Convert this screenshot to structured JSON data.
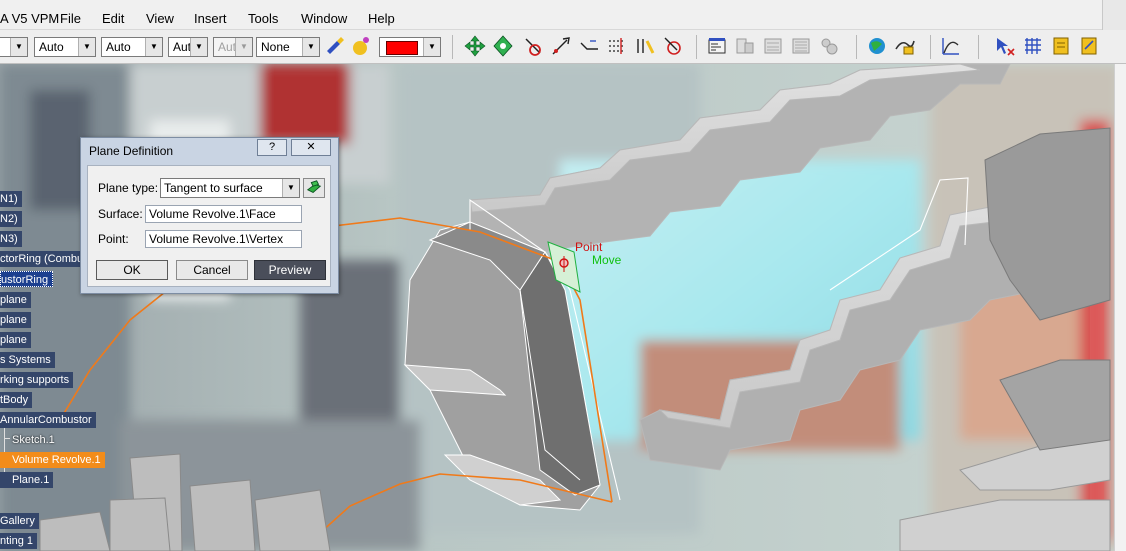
{
  "app": {
    "title": "A V5 VPM",
    "menus": [
      "File",
      "Edit",
      "View",
      "Insert",
      "Tools",
      "Window",
      "Help"
    ]
  },
  "toolbar": {
    "combos": [
      {
        "value": "",
        "disabled": false
      },
      {
        "value": "Auto",
        "disabled": false
      },
      {
        "value": "Auto",
        "disabled": false
      },
      {
        "value": "Aut",
        "disabled": false
      },
      {
        "value": "Aut",
        "disabled": true
      },
      {
        "value": "None",
        "disabled": false
      }
    ],
    "color_value": "#ff0000",
    "icons": [
      "painter-icon",
      "material-icon",
      "move-icon",
      "move-rotate-icon",
      "snap-icon",
      "axis-icon",
      "angle-icon",
      "measure-icon",
      "measure-item-icon",
      "clash-icon",
      "properties-icon",
      "catalog-icon",
      "catalog-2-icon",
      "catalog-3-icon",
      "settings-icon",
      "globe-icon",
      "analysis-icon",
      "curve-icon",
      "select-icon",
      "grid-icon",
      "doc-icon",
      "doc-2-icon"
    ]
  },
  "tree": {
    "items": [
      {
        "label": "N1)",
        "style": "normal"
      },
      {
        "label": "N2)",
        "style": "normal"
      },
      {
        "label": "N3)",
        "style": "normal"
      },
      {
        "label": "ctorRing (Combu",
        "style": "normal"
      },
      {
        "label": "ustorRing",
        "style": "selected"
      },
      {
        "label": "plane",
        "style": "normal"
      },
      {
        "label": "plane",
        "style": "normal"
      },
      {
        "label": "plane",
        "style": "normal"
      },
      {
        "label": "s Systems",
        "style": "normal"
      },
      {
        "label": "rking supports",
        "style": "normal"
      },
      {
        "label": "tBody",
        "style": "normal"
      },
      {
        "label": "AnnularCombustor",
        "style": "normal"
      },
      {
        "label": "Sketch.1",
        "style": "plain"
      },
      {
        "label": "Volume Revolve.1",
        "style": "active"
      },
      {
        "label": "Plane.1",
        "style": "normal"
      },
      {
        "label": "Gallery",
        "style": "normal"
      },
      {
        "label": "nting 1",
        "style": "normal"
      }
    ]
  },
  "dialog": {
    "title": "Plane Definition",
    "help_button": "?",
    "close_button": "✕",
    "plane_type_label": "Plane type:",
    "plane_type_value": "Tangent to surface",
    "surface_label": "Surface:",
    "surface_value": "Volume Revolve.1\\Face",
    "point_label": "Point:",
    "point_value": "Volume Revolve.1\\Vertex",
    "ok": "OK",
    "cancel": "Cancel",
    "preview": "Preview"
  },
  "annotations": {
    "point_label": "Point",
    "move_label": "Move",
    "point_color": "#d01010",
    "move_color": "#10c010"
  }
}
